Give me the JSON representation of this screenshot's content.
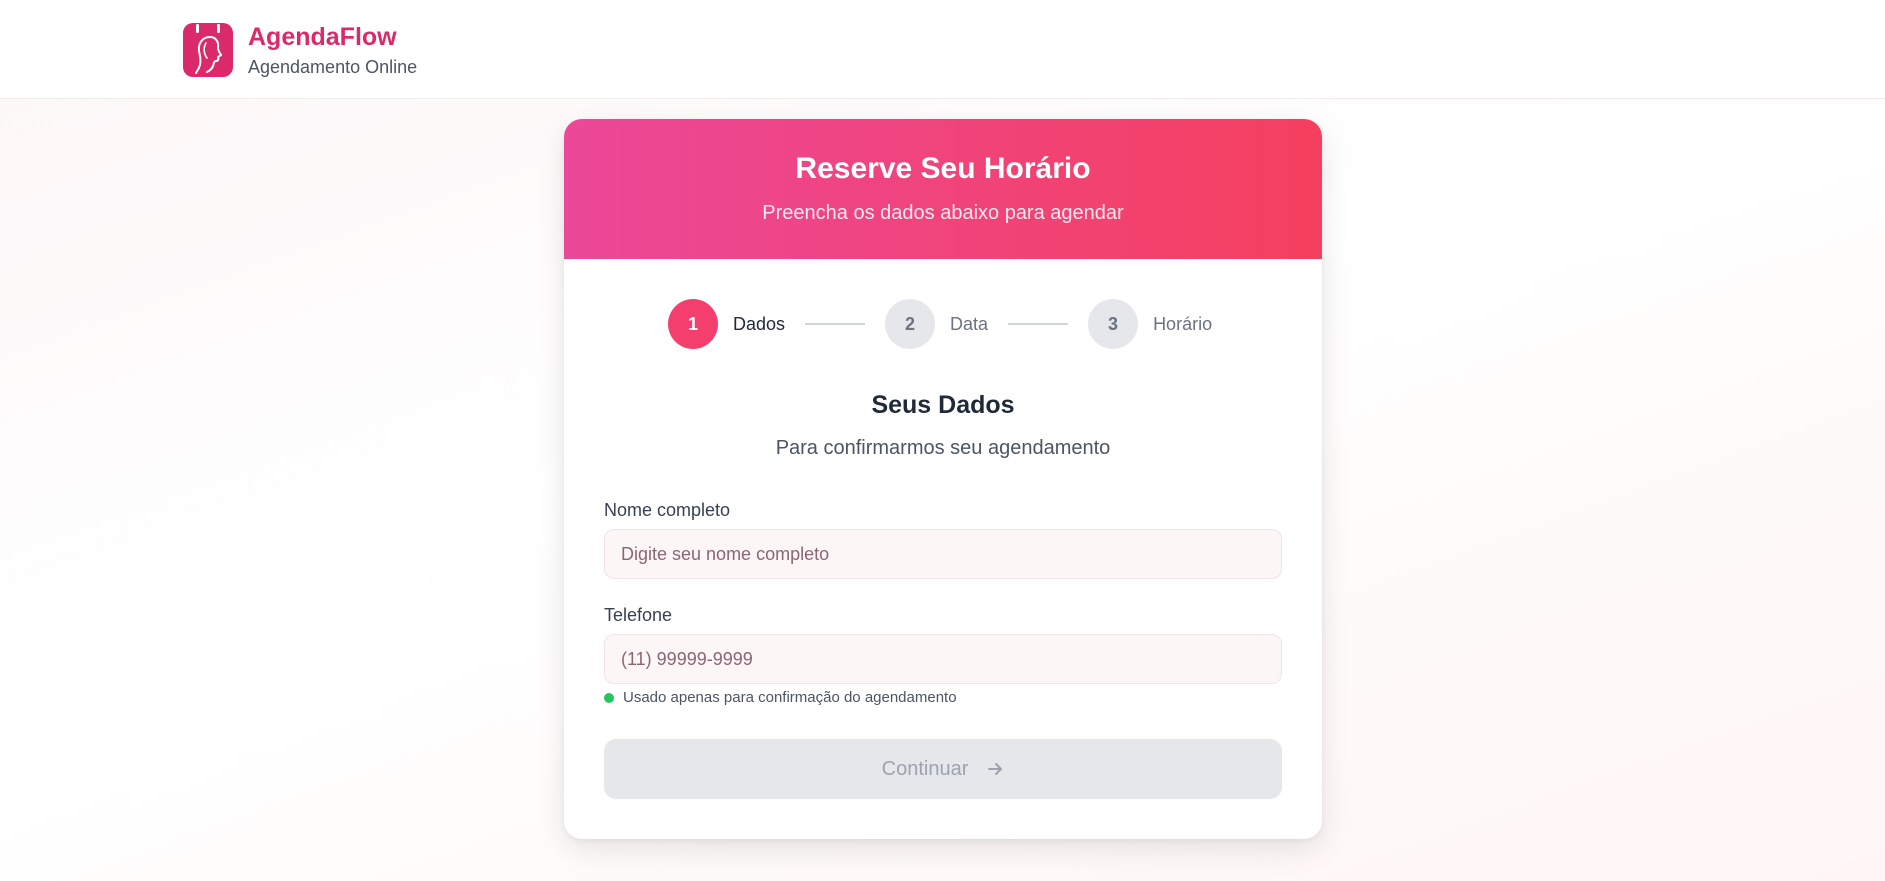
{
  "brand": {
    "name": "AgendaFlow",
    "subtitle": "Agendamento Online",
    "color": "#db2a6a"
  },
  "card": {
    "title": "Reserve Seu Horário",
    "subtitle": "Preencha os dados abaixo para agendar",
    "header_gradient": [
      "#ec4899",
      "#f43f5e"
    ]
  },
  "steps": [
    {
      "number": "1",
      "label": "Dados",
      "state": "active"
    },
    {
      "number": "2",
      "label": "Data",
      "state": "inactive"
    },
    {
      "number": "3",
      "label": "Horário",
      "state": "inactive"
    }
  ],
  "section": {
    "title": "Seus Dados",
    "subtitle": "Para confirmarmos seu agendamento"
  },
  "form": {
    "name_label": "Nome completo",
    "name_placeholder": "Digite seu nome completo",
    "name_value": "",
    "phone_label": "Telefone",
    "phone_placeholder": "(11) 99999-9999",
    "phone_value": "",
    "phone_hint": "Usado apenas para confirmação do agendamento",
    "continue_label": "Continuar"
  },
  "icons": {
    "logo": "calendar-woman-profile-icon",
    "continue": "arrow-right-icon",
    "hint": "green-dot-icon"
  }
}
